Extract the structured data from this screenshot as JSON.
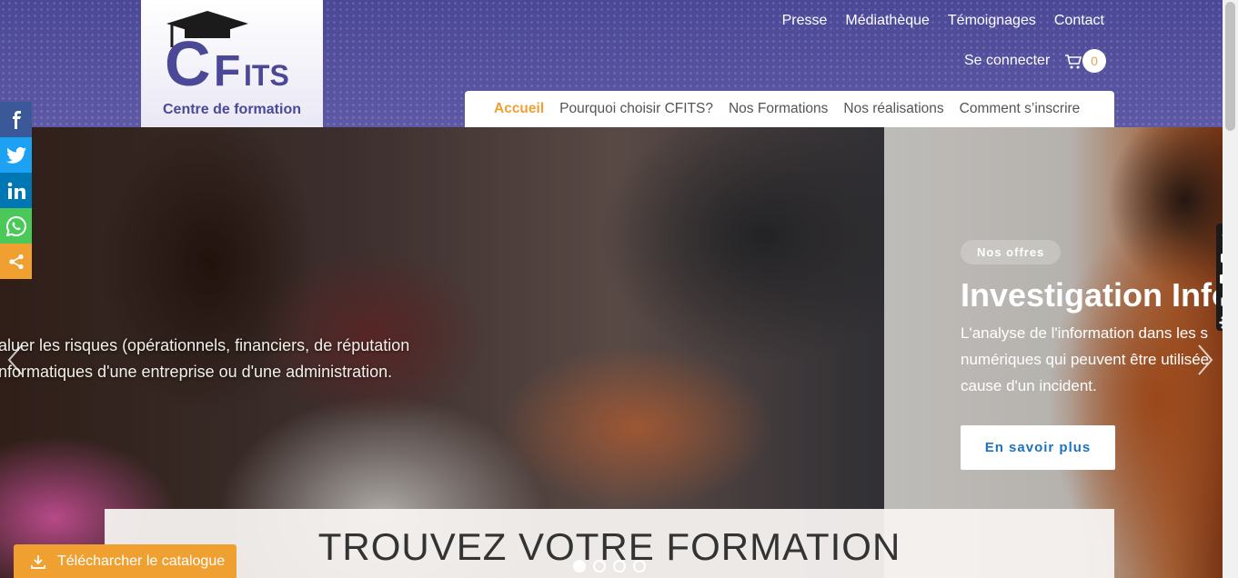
{
  "logo": {
    "mark": "CFITS",
    "tagline": "Centre de formation"
  },
  "topnav": [
    "Presse",
    "Médiathèque",
    "Témoignages",
    "Contact"
  ],
  "account": {
    "login_label": "Se connecter",
    "cart_count": "0"
  },
  "mainnav": {
    "active": "Accueil",
    "items": [
      "Pourquoi choisir CFITS?",
      "Nos Formations",
      "Nos réalisations",
      "Comment s’inscrire"
    ]
  },
  "hero": {
    "slide1_desc_line1": "aluer les risques (opérationnels, financiers, de réputation",
    "slide1_desc_line2": "nformatiques d'une entreprise ou d'une administration.",
    "slide2_badge": "Nos offres",
    "slide2_title": "Investigation Info",
    "slide2_desc_line1": "L'analyse de l'information dans les s",
    "slide2_desc_line2": "numériques qui peuvent être utilisée",
    "slide2_desc_line3": "cause d'un incident.",
    "slide2_button": "En savoir plus",
    "find_title": "TROUVEZ VOTRE FORMATION"
  },
  "carousel": {
    "dot_count": 4,
    "active_index": 0
  },
  "catalog_button": "Télécharcher le catalogue",
  "social": [
    "facebook-icon",
    "twitter-icon",
    "linkedin-icon",
    "whatsapp-icon",
    "share-icon"
  ],
  "colors": {
    "header": "#4b4897",
    "accent": "#f0a030",
    "link_blue": "#1e73be"
  }
}
